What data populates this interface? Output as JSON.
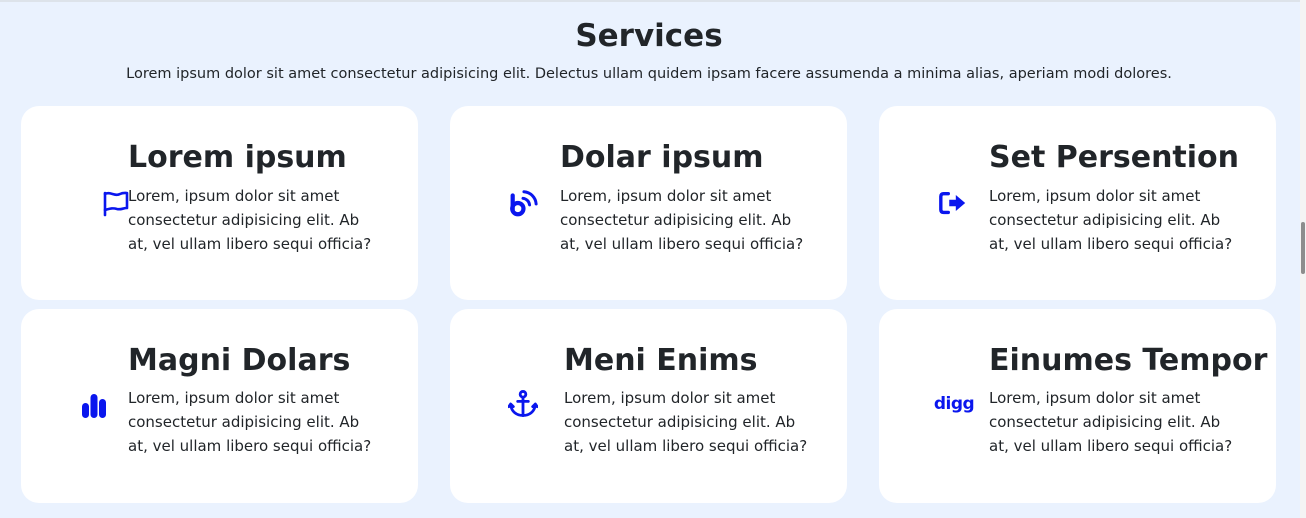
{
  "section": {
    "title": "Services",
    "subtitle": "Lorem ipsum dolor sit amet consectetur adipisicing elit. Delectus ullam quidem ipsam facere assumenda a minima alias, aperiam modi dolores."
  },
  "colors": {
    "background": "#eaf2fe",
    "card": "#ffffff",
    "icon": "#0a16ee",
    "text": "#212529"
  },
  "cards": [
    {
      "title": "Lorem ipsum",
      "text": "Lorem, ipsum dolor sit amet consectetur adipisicing elit. Ab at, vel ullam libero sequi officia?",
      "icon": "flag-icon"
    },
    {
      "title": "Dolar ipsum",
      "text": "Lorem, ipsum dolor sit amet consectetur adipisicing elit. Ab at, vel ullam libero sequi officia?",
      "icon": "blogger-b-icon"
    },
    {
      "title": "Set Persention",
      "text": "Lorem, ipsum dolor sit amet consectetur adipisicing elit. Ab at, vel ullam libero sequi officia?",
      "icon": "sign-out-icon"
    },
    {
      "title": "Magni Dolars",
      "text": "Lorem, ipsum dolor sit amet consectetur adipisicing elit. Ab at, vel ullam libero sequi officia?",
      "icon": "bar-chart-icon"
    },
    {
      "title": "Meni Enims",
      "text": "Lorem, ipsum dolor sit amet consectetur adipisicing elit. Ab at, vel ullam libero sequi officia?",
      "icon": "anchor-icon"
    },
    {
      "title": "Einumes Tempor",
      "text": "Lorem, ipsum dolor sit amet consectetur adipisicing elit. Ab at, vel ullam libero sequi officia?",
      "icon": "digg-icon",
      "icon_text": "digg"
    }
  ]
}
